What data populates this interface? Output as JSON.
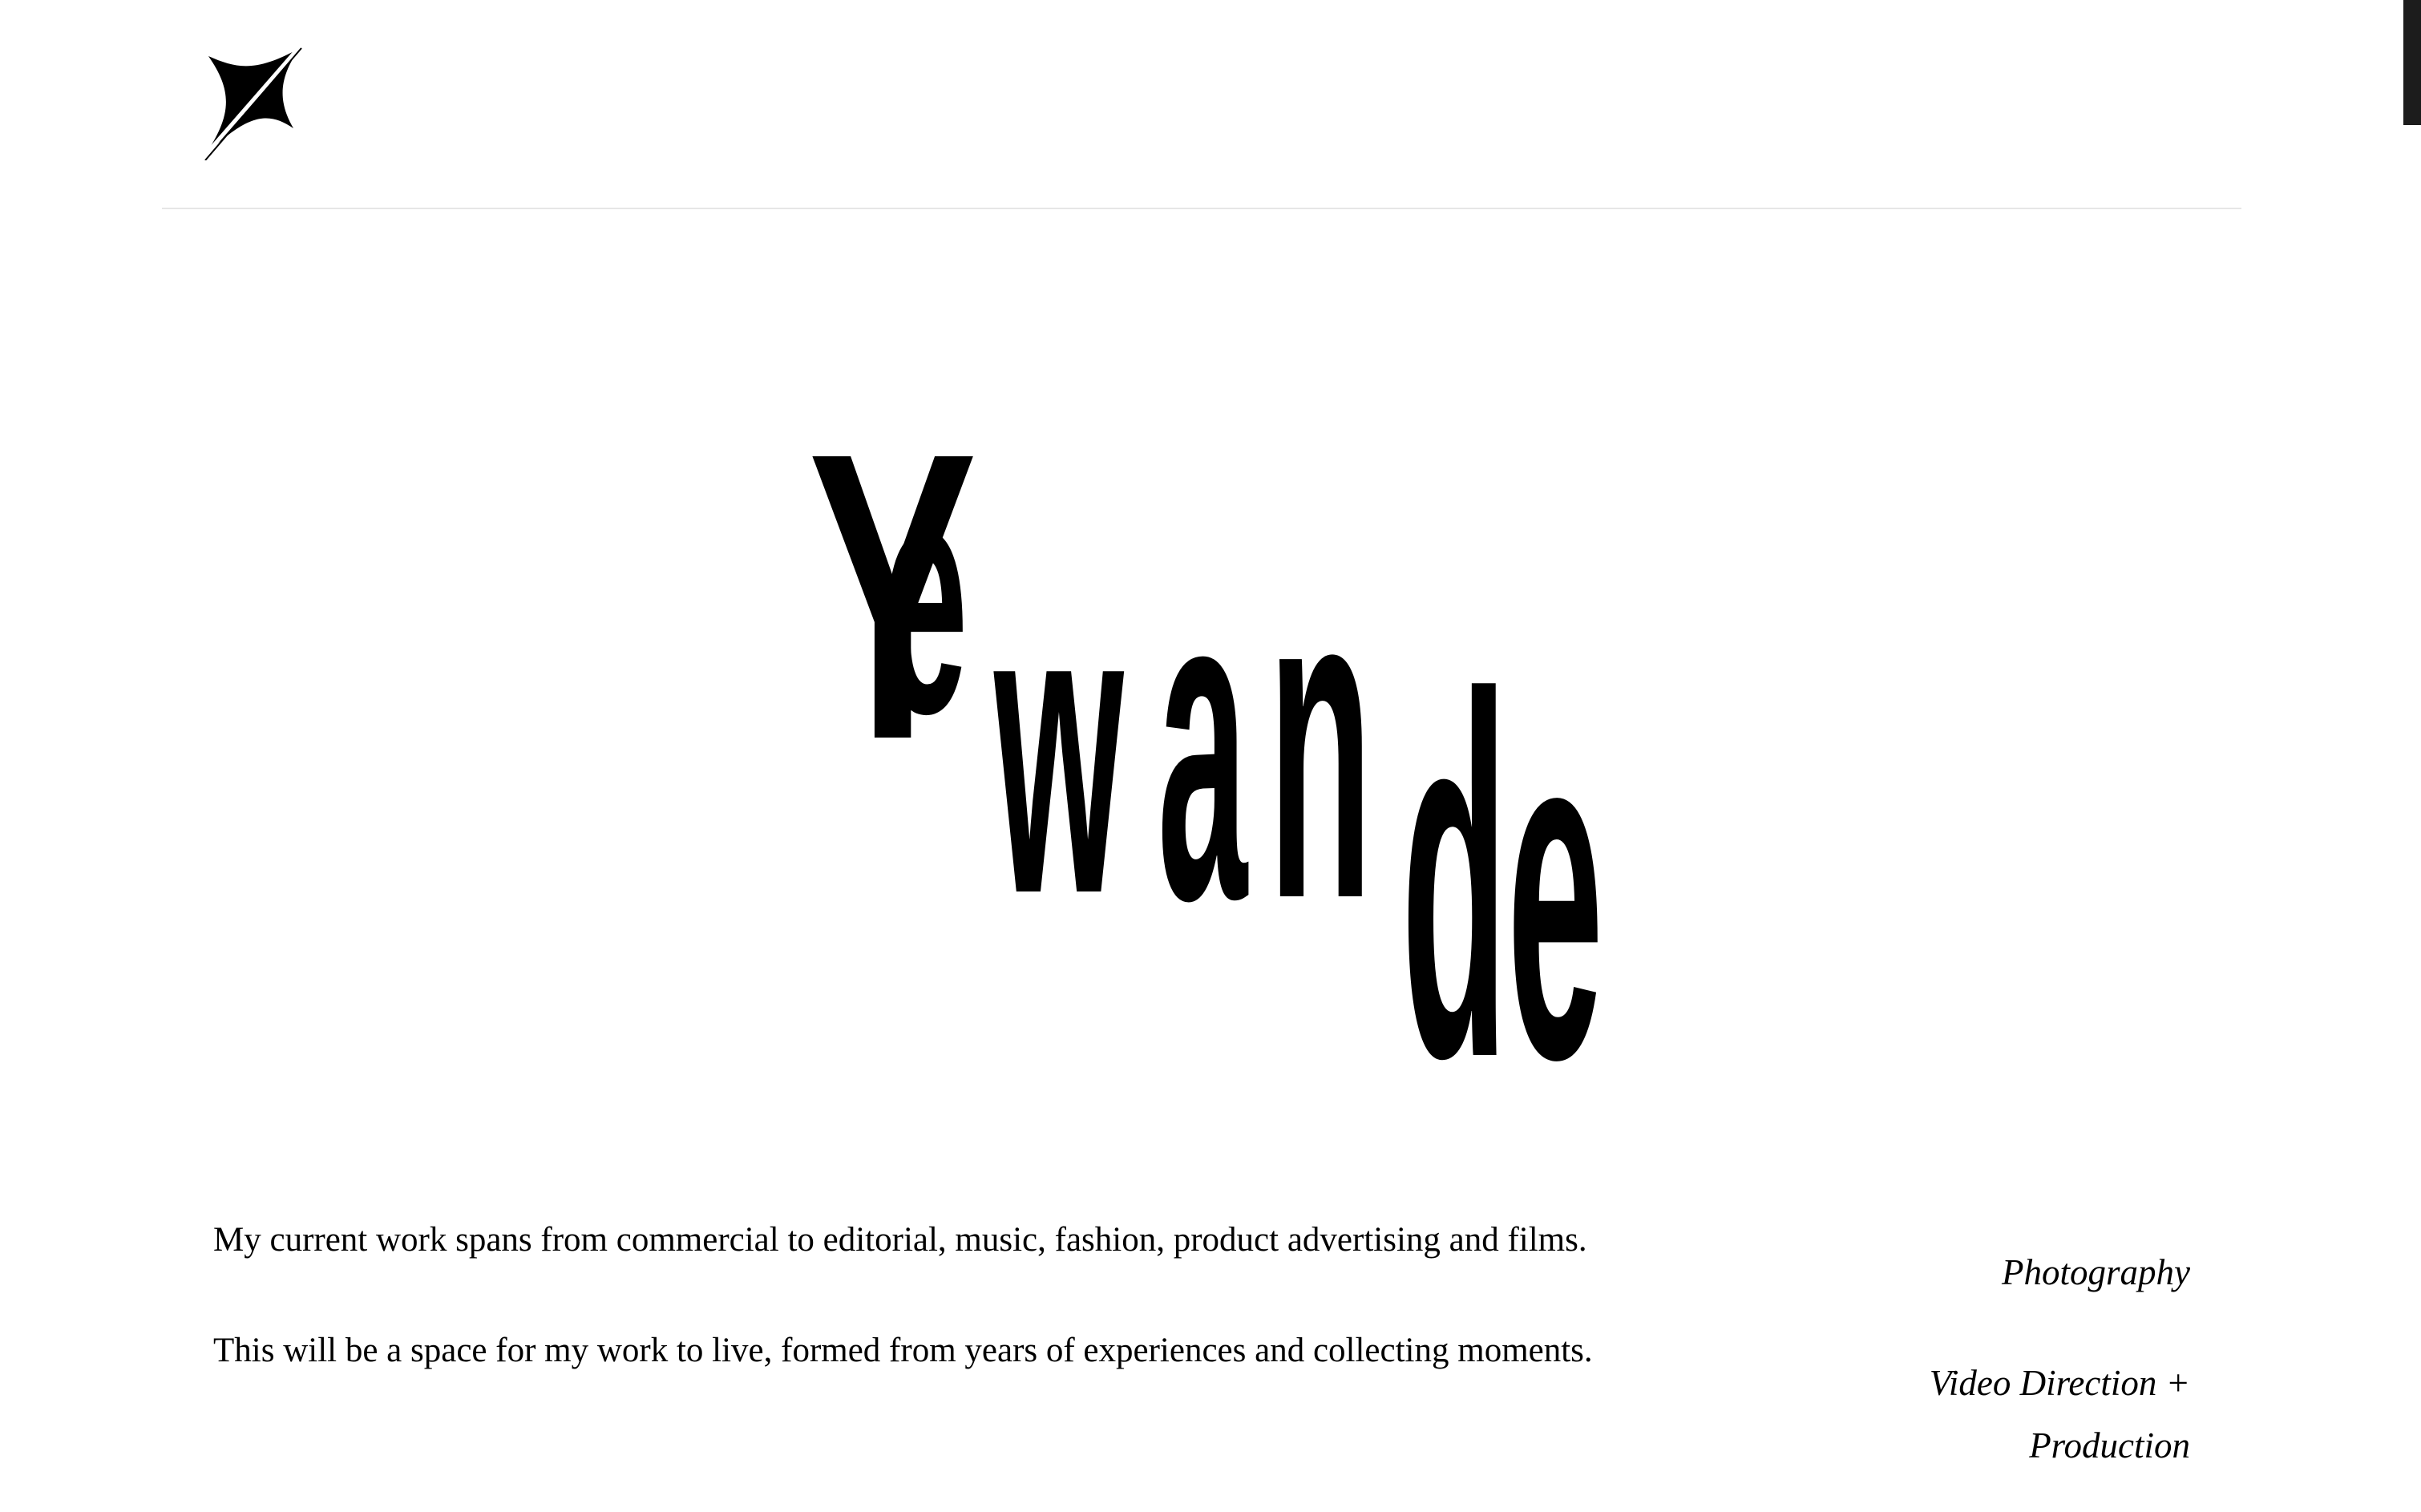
{
  "brand": {
    "logo_icon": "four-point-star-slash-icon",
    "wordmark_letters": [
      "Y",
      "e",
      "w",
      "a",
      "n",
      "d",
      "e"
    ]
  },
  "about": {
    "paragraphs": [
      "My current work spans from commercial to editorial, music, fashion, product advertising and films.",
      "This will be a space for my work to live, formed from years of experiences and collecting moments."
    ]
  },
  "services": {
    "items": [
      "Photography",
      "Video Direction + Production"
    ]
  },
  "colors": {
    "background": "#ffffff",
    "text": "#000000",
    "divider": "#e6e6e6"
  }
}
